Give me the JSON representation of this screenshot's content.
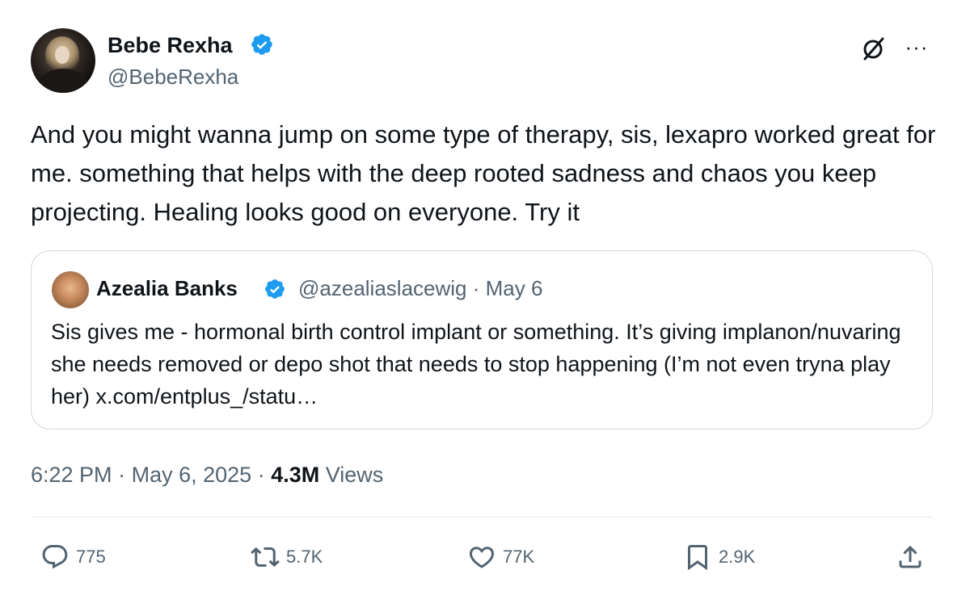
{
  "author": {
    "name": "Bebe Rexha",
    "handle": "@BebeRexha",
    "verified": true
  },
  "header_icons": {
    "grok": "grok-icon",
    "more": "more-icon",
    "more_glyph": "···"
  },
  "tweet": {
    "text": "And you might wanna jump on some type of therapy, sis, lexapro worked great for me. something that helps with the deep rooted sadness and chaos you keep projecting. Healing looks good on everyone. Try it"
  },
  "quote": {
    "name": "Azealia Banks",
    "verified": true,
    "handle": "@azealiaslacewig",
    "separator": "·",
    "date": "May 6",
    "text": "Sis gives me -  hormonal birth control implant or something. It’s giving implanon/nuvaring she needs removed or depo shot that needs to stop happening (I’m not even tryna play her) x.com/entplus_/statu…"
  },
  "meta": {
    "time": "6:22 PM",
    "separator": "·",
    "date": "May 6, 2025",
    "views_count": "4.3M",
    "views_label": "Views"
  },
  "actions": {
    "replies": "775",
    "reposts": "5.7K",
    "likes": "77K",
    "bookmarks": "2.9K"
  },
  "colors": {
    "text_primary": "#0f1419",
    "text_secondary": "#536471",
    "verified_blue": "#1d9bf0",
    "border": "#cfd9de"
  }
}
